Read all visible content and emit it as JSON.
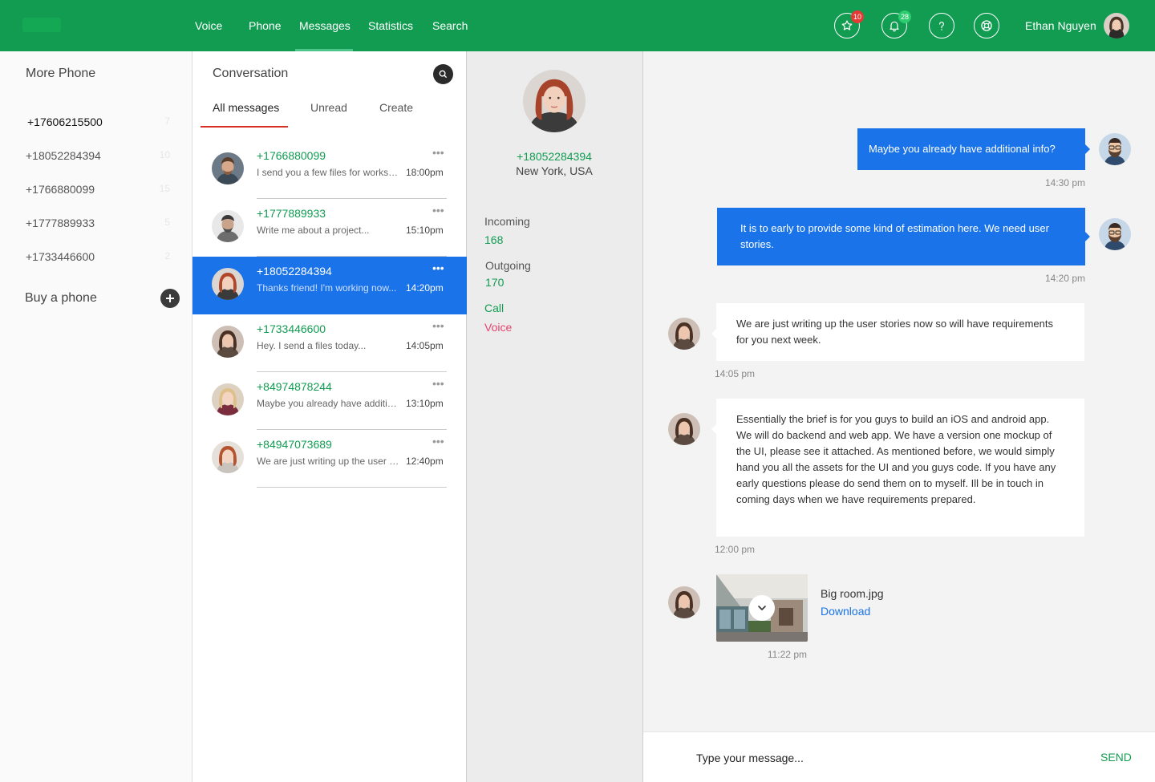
{
  "nav": {
    "items": [
      "Voice",
      "Phone",
      "Messages",
      "Statistics",
      "Search"
    ],
    "active": "Messages"
  },
  "header": {
    "star_count": "10",
    "bell_count": "28",
    "user_name": "Ethan Nguyen"
  },
  "sidebar": {
    "title": "More Phone",
    "phones": [
      {
        "number": "+17606215500",
        "count": "7"
      },
      {
        "number": "+18052284394",
        "count": "10"
      },
      {
        "number": "+1766880099",
        "count": "15"
      },
      {
        "number": "+1777889933",
        "count": "5"
      },
      {
        "number": "+1733446600",
        "count": "2"
      }
    ],
    "buy_label": "Buy a phone"
  },
  "conversation": {
    "title": "Conversation",
    "tabs": [
      "All messages",
      "Unread",
      "Create"
    ],
    "items": [
      {
        "number": "+1766880099",
        "preview": "I send you a few files for workshop...",
        "time": "18:00pm"
      },
      {
        "number": "+1777889933",
        "preview": "Write me about a project...",
        "time": "15:10pm"
      },
      {
        "number": "+18052284394",
        "preview": "Thanks friend! I'm working now...",
        "time": "14:20pm"
      },
      {
        "number": "+1733446600",
        "preview": "Hey. I send a files today...",
        "time": "14:05pm"
      },
      {
        "number": "+84974878244",
        "preview": "Maybe you already have additional info?",
        "time": "13:10pm"
      },
      {
        "number": "+84947073689",
        "preview": "We are just writing up the user stories...",
        "time": "12:40pm"
      }
    ]
  },
  "contact": {
    "number": "+18052284394",
    "location": "New York, USA",
    "incoming_label": "Incoming",
    "incoming_value": "168",
    "outgoing_label": "Outgoing",
    "outgoing_value": "170",
    "call_label": "Call",
    "voice_label": "Voice"
  },
  "chat": {
    "messages": [
      {
        "text": "Maybe you already have additional info?",
        "time": "14:30 pm"
      },
      {
        "text": "It is to early to provide some kind of estimation here. We need user stories.",
        "time": "14:20 pm"
      },
      {
        "text": "We are just writing up the user stories now so will have requirements for you next week.",
        "time": "14:05 pm"
      },
      {
        "text": "Essentially the brief is for you guys to build an iOS and android app. We will do backend and web app. We have a version one mockup of the UI, please see it attached. As mentioned before, we would simply hand you all the assets for the UI and you guys code. If you have any early questions please do send them on to myself. Ill be in touch in coming days when we have requirements prepared.",
        "time": "12:00 pm"
      }
    ],
    "attachment": {
      "name": "Big room.jpg",
      "action": "Download",
      "time": "11:22 pm"
    },
    "composer_placeholder": "Type your message...",
    "send_label": "SEND"
  },
  "colors": {
    "brand_green": "#119c52",
    "accent_blue": "#1a73e8",
    "voice_pink": "#e8436e",
    "badge_red": "#e53935",
    "badge_green": "#2ecc71"
  }
}
